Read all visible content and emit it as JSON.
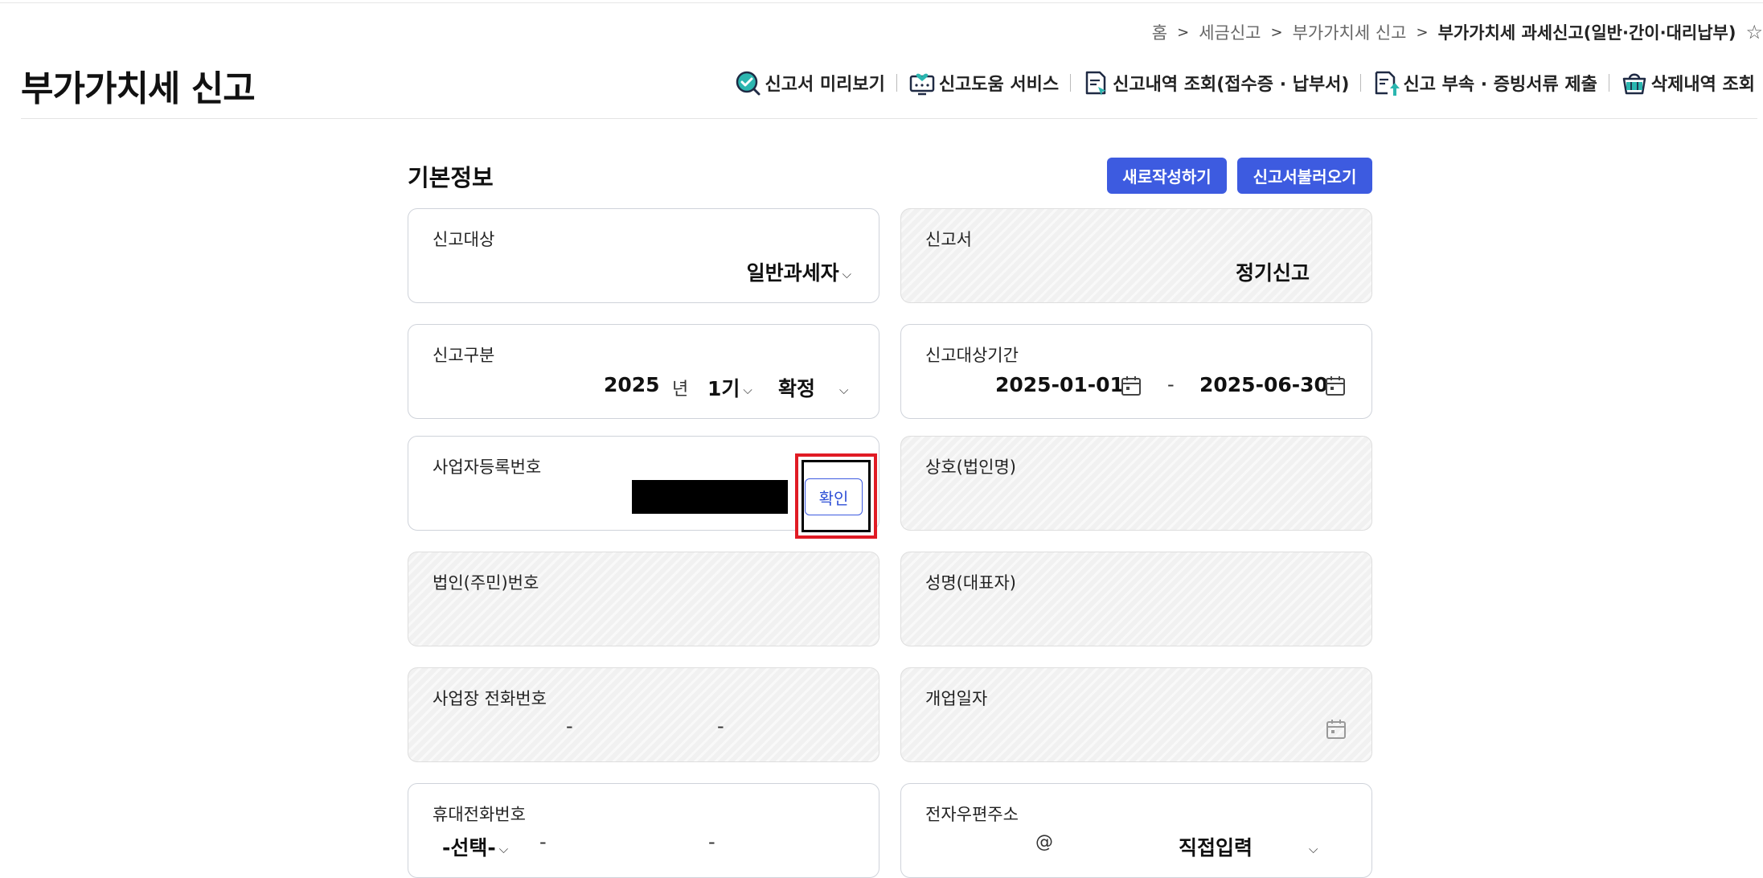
{
  "breadcrumb": {
    "items": [
      "홈",
      "세금신고",
      "부가가치세 신고",
      "부가가치세 과세신고(일반·간이·대리납부)"
    ],
    "separator": ">",
    "star": "☆"
  },
  "header": {
    "title": "부가가치세 신고",
    "tools": [
      {
        "label": "신고서 미리보기",
        "icon": "check-magnifier-icon"
      },
      {
        "label": "신고도움 서비스",
        "icon": "monitor-heart-icon"
      },
      {
        "label": "신고내역 조회(접수증 · 납부서)",
        "icon": "document-search-icon"
      },
      {
        "label": "신고 부속 · 증빙서류 제출",
        "icon": "document-upload-icon"
      },
      {
        "label": "삭제내역 조회",
        "icon": "basket-icon"
      }
    ]
  },
  "section": {
    "title": "기본정보",
    "new_button": "새로작성하기",
    "load_button": "신고서불러오기"
  },
  "fields": {
    "report_target": {
      "label": "신고대상",
      "value": "일반과세자"
    },
    "report_form": {
      "label": "신고서",
      "value": "정기신고"
    },
    "report_division": {
      "label": "신고구분",
      "year": "2025",
      "year_unit": "년",
      "period": "1기",
      "type": "확정"
    },
    "report_period": {
      "label": "신고대상기간",
      "from": "2025-01-01",
      "sep": "-",
      "to": "2025-06-30"
    },
    "business_reg_no": {
      "label": "사업자등록번호",
      "confirm_button": "확인"
    },
    "company_name": {
      "label": "상호(법인명)"
    },
    "corp_no": {
      "label": "법인(주민)번호"
    },
    "representative": {
      "label": "성명(대표자)"
    },
    "business_phone": {
      "label": "사업장 전화번호",
      "sep": "-"
    },
    "open_date": {
      "label": "개업일자"
    },
    "mobile_phone": {
      "label": "휴대전화번호",
      "select": "-선택-",
      "sep": "-"
    },
    "email": {
      "label": "전자우편주소",
      "at": "@",
      "domain_select": "직접입력"
    }
  },
  "colors": {
    "primary": "#3d5be0",
    "highlight": "#e01b24",
    "disabled_bg": "#f1f1f1"
  }
}
